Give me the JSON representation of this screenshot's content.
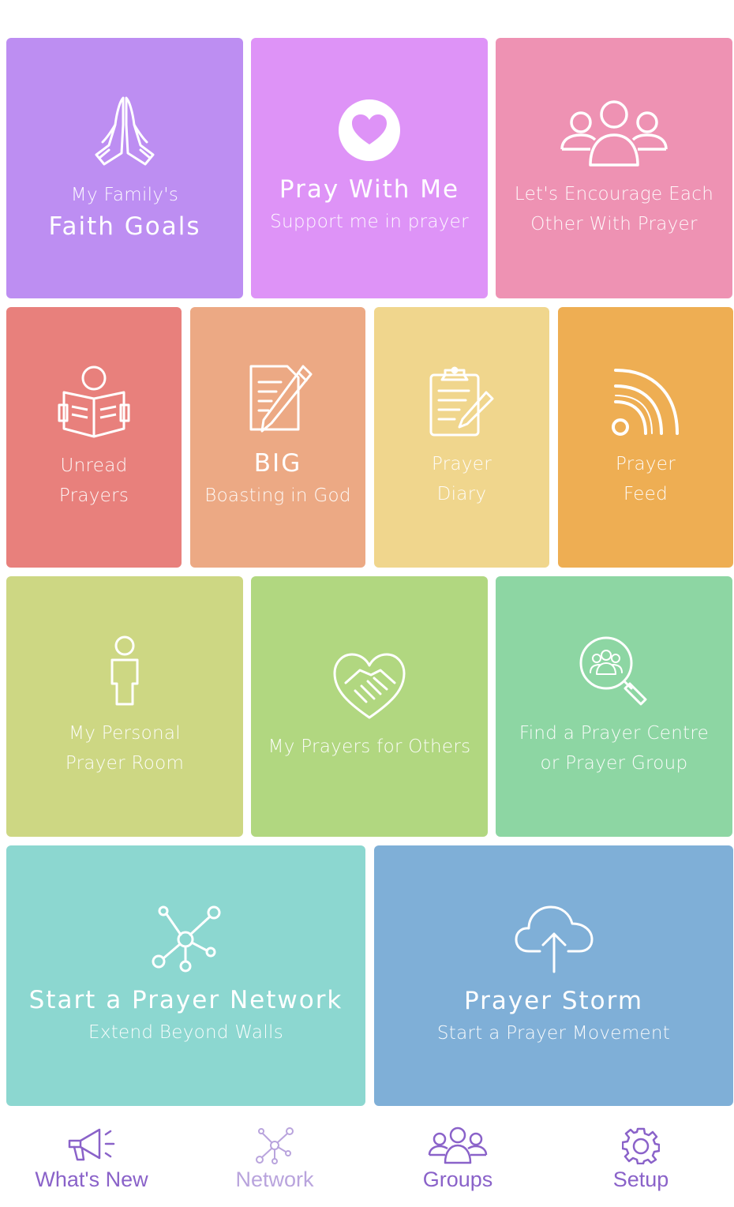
{
  "colors": {
    "faith_goals": "#bd8ef2",
    "pray_with_me": "#de93f7",
    "encourage": "#ee92b3",
    "unread": "#e8807c",
    "big": "#eca984",
    "diary": "#f0d68d",
    "feed": "#eeae53",
    "personal_room": "#cdd783",
    "prayers_for_others": "#b1d780",
    "find_centre": "#8dd6a3",
    "network": "#8cd7d0",
    "storm": "#7fafd7",
    "nav_active": "#8a62c9"
  },
  "tiles": {
    "faith_goals": {
      "icon": "praying-hands-icon",
      "line1": "My Family's",
      "line2": "Faith Goals"
    },
    "pray_with_me": {
      "icon": "heart-icon",
      "title": "Pray With Me",
      "subtitle": "Support me in prayer"
    },
    "encourage": {
      "icon": "people-group-icon",
      "line1": "Let's Encourage Each",
      "line2": "Other With Prayer"
    },
    "unread": {
      "icon": "reading-person-icon",
      "line1": "Unread",
      "line2": "Prayers"
    },
    "big": {
      "icon": "notepad-pen-icon",
      "title": "BIG",
      "subtitle": "Boasting in God"
    },
    "diary": {
      "icon": "clipboard-pencil-icon",
      "line1": "Prayer",
      "line2": "Diary"
    },
    "feed": {
      "icon": "rss-feed-icon",
      "line1": "Prayer",
      "line2": "Feed"
    },
    "personal_room": {
      "icon": "person-icon",
      "line1": "My Personal",
      "line2": "Prayer Room"
    },
    "prayers_for_others": {
      "icon": "handshake-heart-icon",
      "line1": "My Prayers for Others"
    },
    "find_centre": {
      "icon": "group-search-icon",
      "line1": "Find a Prayer Centre",
      "line2": "or Prayer Group"
    },
    "network": {
      "icon": "network-nodes-icon",
      "title": "Start a Prayer Network",
      "subtitle": "Extend Beyond Walls"
    },
    "storm": {
      "icon": "cloud-upload-icon",
      "title": "Prayer Storm",
      "subtitle": "Start a Prayer Movement"
    }
  },
  "nav": {
    "whats_new": {
      "icon": "megaphone-icon",
      "label": "What's New"
    },
    "network": {
      "icon": "network-icon",
      "label": "Network"
    },
    "groups": {
      "icon": "groups-icon",
      "label": "Groups"
    },
    "setup": {
      "icon": "gear-icon",
      "label": "Setup"
    }
  }
}
